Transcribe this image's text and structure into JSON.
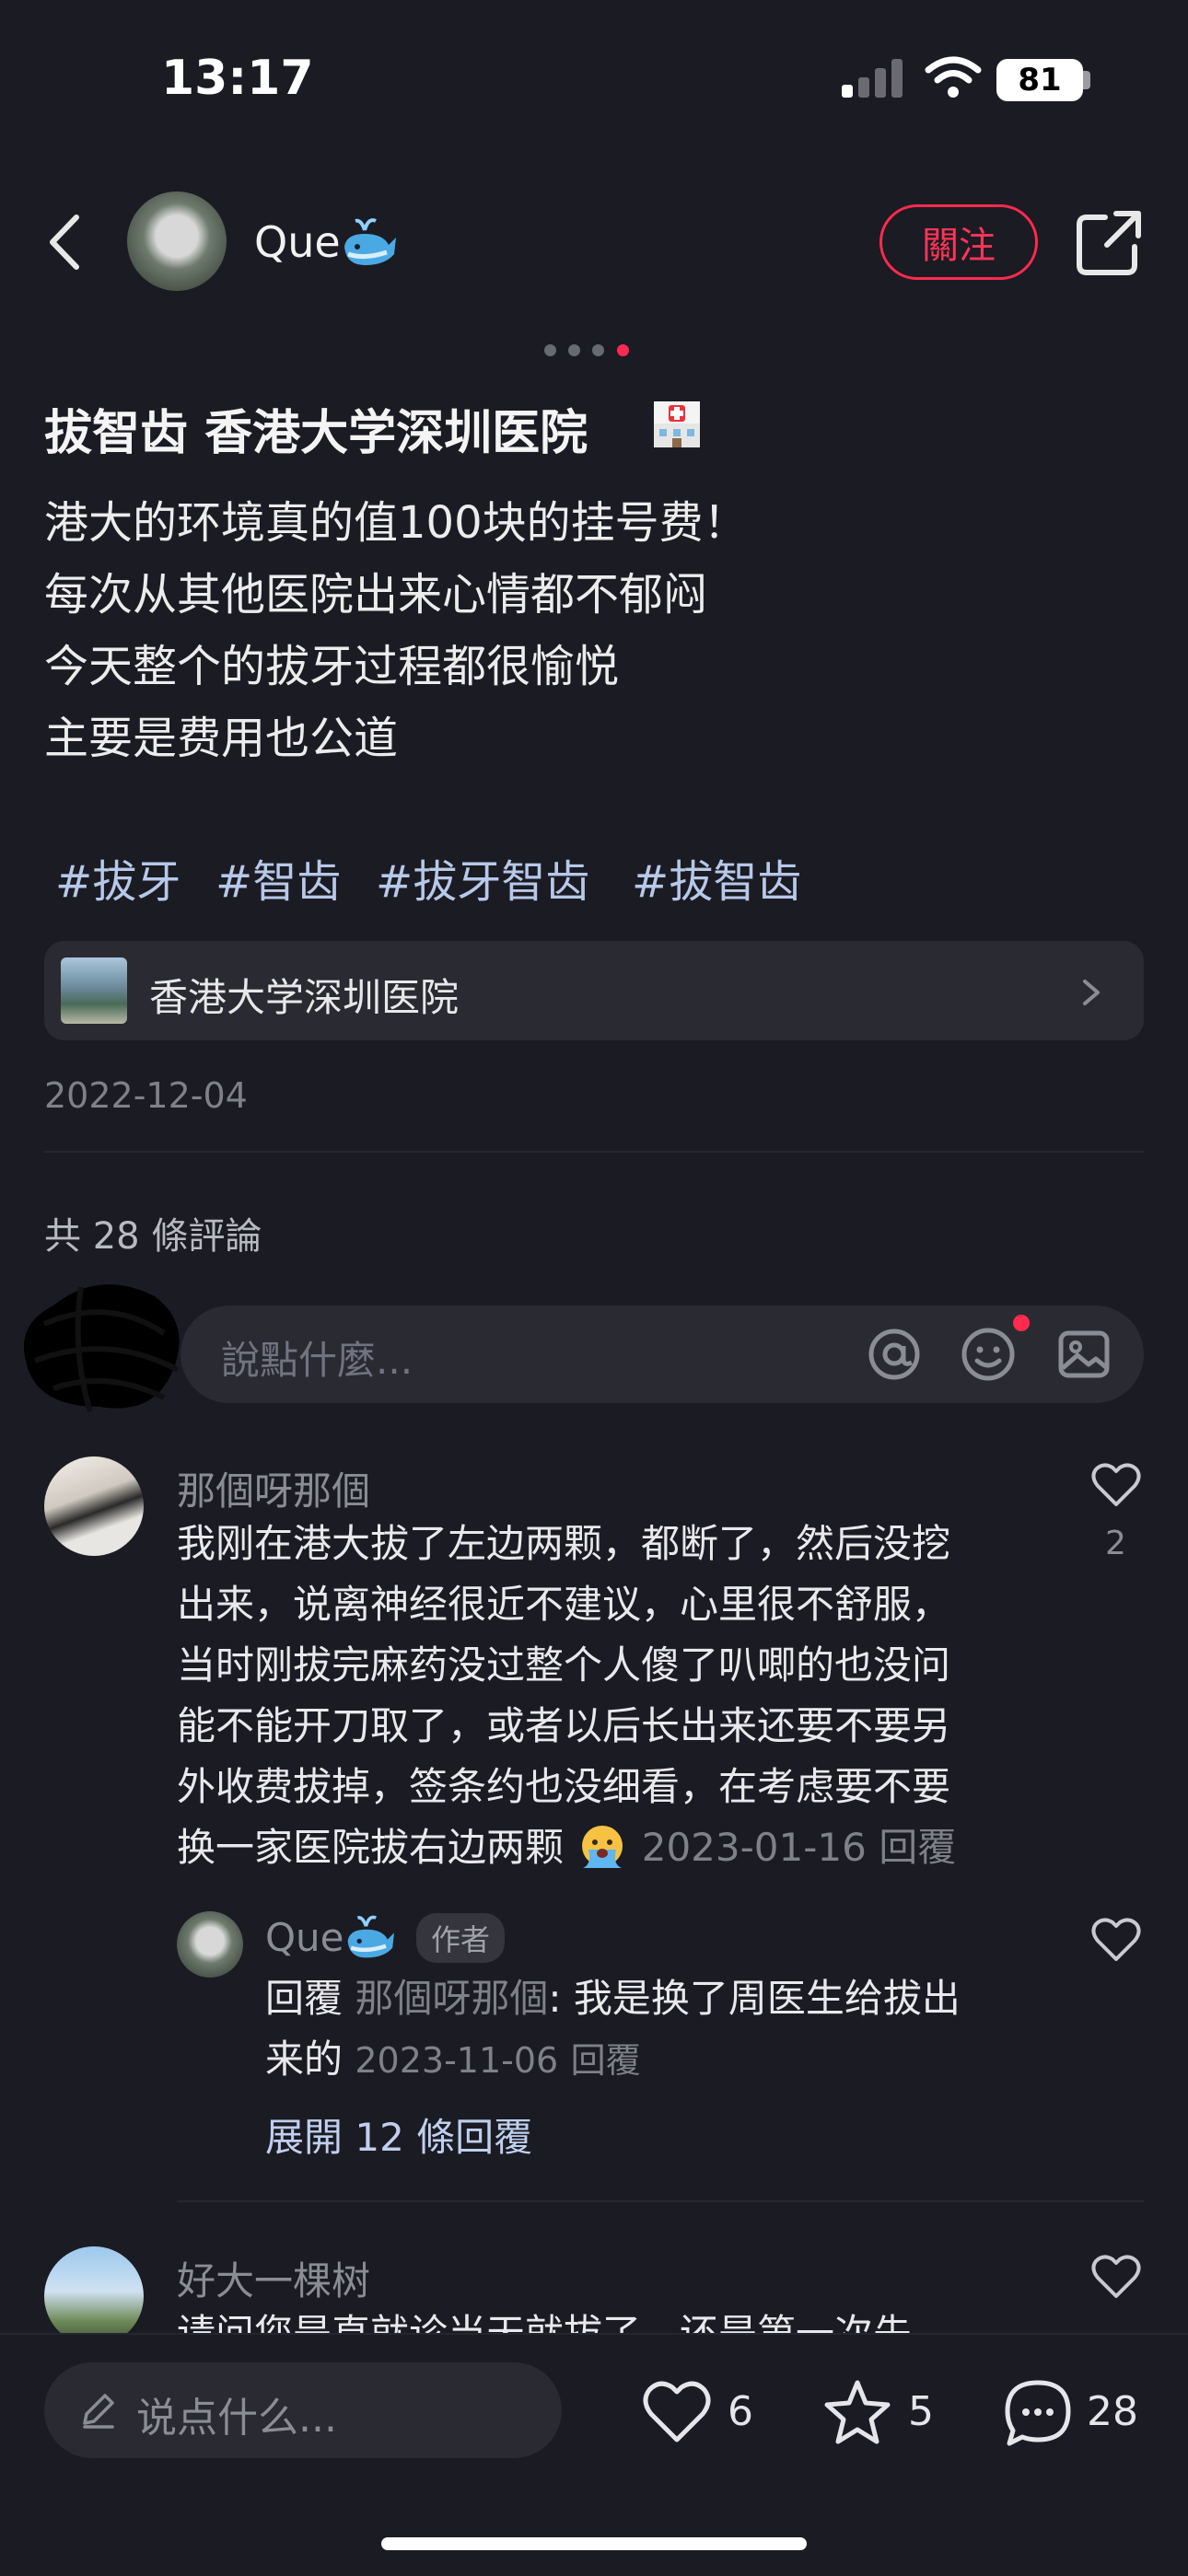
{
  "status_bar": {
    "time": "13:17",
    "battery": "81"
  },
  "header": {
    "author": "Que",
    "follow_label": "關注"
  },
  "post": {
    "title": "拔智齿 香港大学深圳医院",
    "lines": [
      "港大的环境真的值100块的挂号费！",
      "每次从其他医院出来心情都不郁闷",
      "今天整个的拔牙过程都很愉悦",
      "主要是费用也公道"
    ],
    "tags": [
      "#拔牙",
      "#智齿",
      "#拔牙智齿",
      "#拔智齿"
    ],
    "location": "香港大学深圳医院",
    "date": "2022-12-04"
  },
  "comments_section": {
    "count_label": "共 28 條評論",
    "input_placeholder": "說點什麼...",
    "comments": [
      {
        "name": "那個呀那個",
        "lines": [
          "我刚在港大拔了左边两颗，都断了，然后没挖",
          "出来，说离神经很近不建议，心里很不舒服，",
          "当时刚拔完麻药没过整个人傻了叭唧的也没问",
          "能不能开刀取了，或者以后长出来还要不要另",
          "外收费拔掉，签条约也没细看，在考虑要不要",
          "换一家医院拔右边两颗"
        ],
        "date": "2023-01-16",
        "reply_label": "回覆",
        "likes": "2"
      }
    ],
    "reply": {
      "name": "Que",
      "badge": "作者",
      "prefix": "回覆",
      "target": "那個呀那個",
      "line1": ": 我是换了周医生给拔出",
      "line2": "来的",
      "date": "2023-11-06",
      "reply_label": "回覆",
      "expand_label": "展開 12 條回覆"
    },
    "next_comment": {
      "name": "好大一棵树",
      "partial_text": "请问您是直就诊当天就拔了，还是第一次先"
    }
  },
  "bottom_bar": {
    "input_placeholder": "说点什么...",
    "likes": "6",
    "favorites": "5",
    "comments": "28"
  },
  "colors": {
    "accent": "#ff2a4e",
    "background": "#1b1b23",
    "tag": "#b7c8e8"
  },
  "icons": [
    "back-icon",
    "share-icon",
    "at-icon",
    "emoji-icon",
    "image-icon",
    "heart-icon",
    "star-icon",
    "comment-icon",
    "pencil-icon",
    "chevron-right-icon"
  ]
}
